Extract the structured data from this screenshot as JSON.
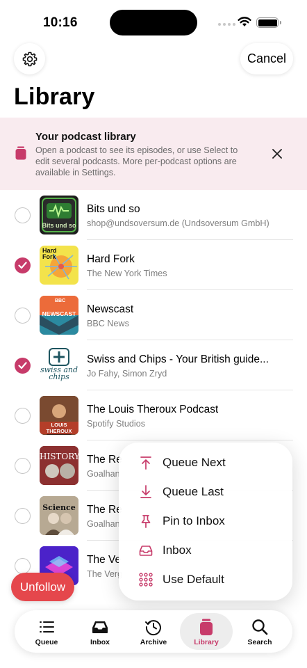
{
  "status_bar": {
    "time": "10:16"
  },
  "header": {
    "cancel_label": "Cancel",
    "title": "Library"
  },
  "banner": {
    "title": "Your podcast library",
    "text": "Open a podcast to see its episodes, or use Select to edit several podcasts. More per-podcast options are available in Settings."
  },
  "podcasts": [
    {
      "name": "Bits und so",
      "author": "shop@undsoversum.de (Undsoversum GmbH)",
      "selected": false,
      "art_text": "Bits und so"
    },
    {
      "name": "Hard Fork",
      "author": "The New York Times",
      "selected": true,
      "art_text": "Hard Fork"
    },
    {
      "name": "Newscast",
      "author": "BBC News",
      "selected": false,
      "art_text": "NEWSCAST",
      "art_badge": "BBC"
    },
    {
      "name": "Swiss and Chips - Your British guide...",
      "author": "Jo Fahy, Simon Zryd",
      "selected": true,
      "art_text": "swiss and chips"
    },
    {
      "name": "The Louis Theroux Podcast",
      "author": "Spotify Studios",
      "selected": false,
      "art_text": "LOUIS THEROUX"
    },
    {
      "name": "The Re",
      "author": "Goalhan",
      "selected": false,
      "art_text": "HISTORY"
    },
    {
      "name": "The Re",
      "author": "Goalhan",
      "selected": false,
      "art_text": "Science"
    },
    {
      "name": "The Ve",
      "author": "The Verg",
      "selected": false,
      "art_text": ""
    }
  ],
  "context_menu": {
    "items": [
      {
        "label": "Queue Next",
        "icon": "arrow-up-to-line-icon"
      },
      {
        "label": "Queue Last",
        "icon": "arrow-down-to-line-icon"
      },
      {
        "label": "Pin to Inbox",
        "icon": "pin-icon"
      },
      {
        "label": "Inbox",
        "icon": "inbox-tray-icon"
      },
      {
        "label": "Use Default",
        "icon": "grid-dots-icon"
      }
    ]
  },
  "unfollow_label": "Unfollow",
  "tabbar": {
    "tabs": [
      {
        "label": "Queue",
        "icon": "list-icon",
        "active": false
      },
      {
        "label": "Inbox",
        "icon": "inbox-icon",
        "active": false
      },
      {
        "label": "Archive",
        "icon": "clock-history-icon",
        "active": false
      },
      {
        "label": "Library",
        "icon": "library-icon",
        "active": true
      },
      {
        "label": "Search",
        "icon": "magnifier-icon",
        "active": false
      }
    ]
  },
  "colors": {
    "accent": "#c73b6a",
    "banner_bg": "#f9ebef",
    "unfollow": "#e5474c"
  }
}
